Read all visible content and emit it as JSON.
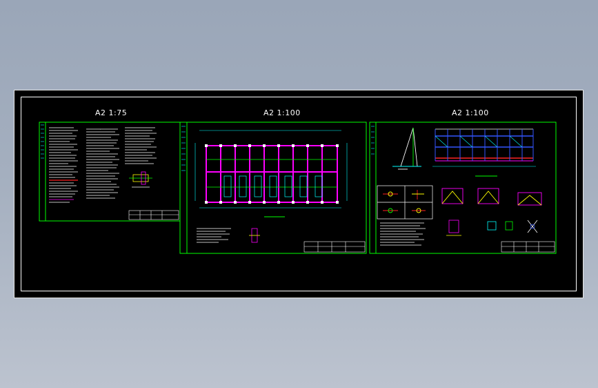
{
  "sheets": [
    {
      "scale_label": "A2   1:75"
    },
    {
      "scale_label": "A2   1:100"
    },
    {
      "scale_label": "A2   1:100"
    }
  ],
  "colors": {
    "background": "#000000",
    "frame": "#00ff00",
    "walls": "#ff00ff",
    "dimensions": "#00ffff",
    "notes": "#ffffff",
    "members": "#3355ff",
    "highlight": "#ff2222"
  }
}
